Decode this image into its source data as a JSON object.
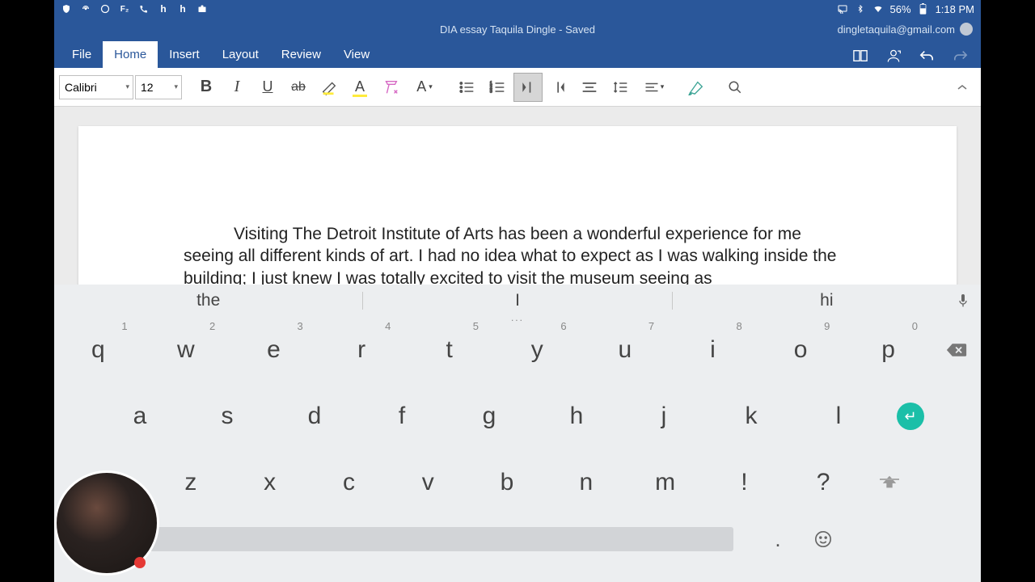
{
  "status": {
    "battery": "56%",
    "time": "1:18 PM"
  },
  "title": "DIA essay Taquila Dingle - Saved",
  "account": "dingletaquila@gmail.com",
  "tabs": [
    "File",
    "Home",
    "Insert",
    "Layout",
    "Review",
    "View"
  ],
  "active_tab": "Home",
  "font": {
    "name": "Calibri",
    "size": "12"
  },
  "document": {
    "paragraph": "Visiting The Detroit Institute of Arts has been a wonderful experience for me seeing all different kinds of art. I had no idea what to expect as I was walking inside the building; I just knew I was totally excited to visit the museum seeing as"
  },
  "suggestions": [
    "the",
    "I",
    "hi"
  ],
  "keys": {
    "row1": [
      {
        "k": "q",
        "n": "1"
      },
      {
        "k": "w",
        "n": "2"
      },
      {
        "k": "e",
        "n": "3"
      },
      {
        "k": "r",
        "n": "4"
      },
      {
        "k": "t",
        "n": "5"
      },
      {
        "k": "y",
        "n": "6"
      },
      {
        "k": "u",
        "n": "7"
      },
      {
        "k": "i",
        "n": "8"
      },
      {
        "k": "o",
        "n": "9"
      },
      {
        "k": "p",
        "n": "0"
      }
    ],
    "row2": [
      "a",
      "s",
      "d",
      "f",
      "g",
      "h",
      "j",
      "k",
      "l"
    ],
    "row3": [
      "z",
      "x",
      "c",
      "v",
      "b",
      "n",
      "m",
      "!",
      "?"
    ],
    "bottom": {
      "comma": ",",
      "period": "."
    }
  }
}
